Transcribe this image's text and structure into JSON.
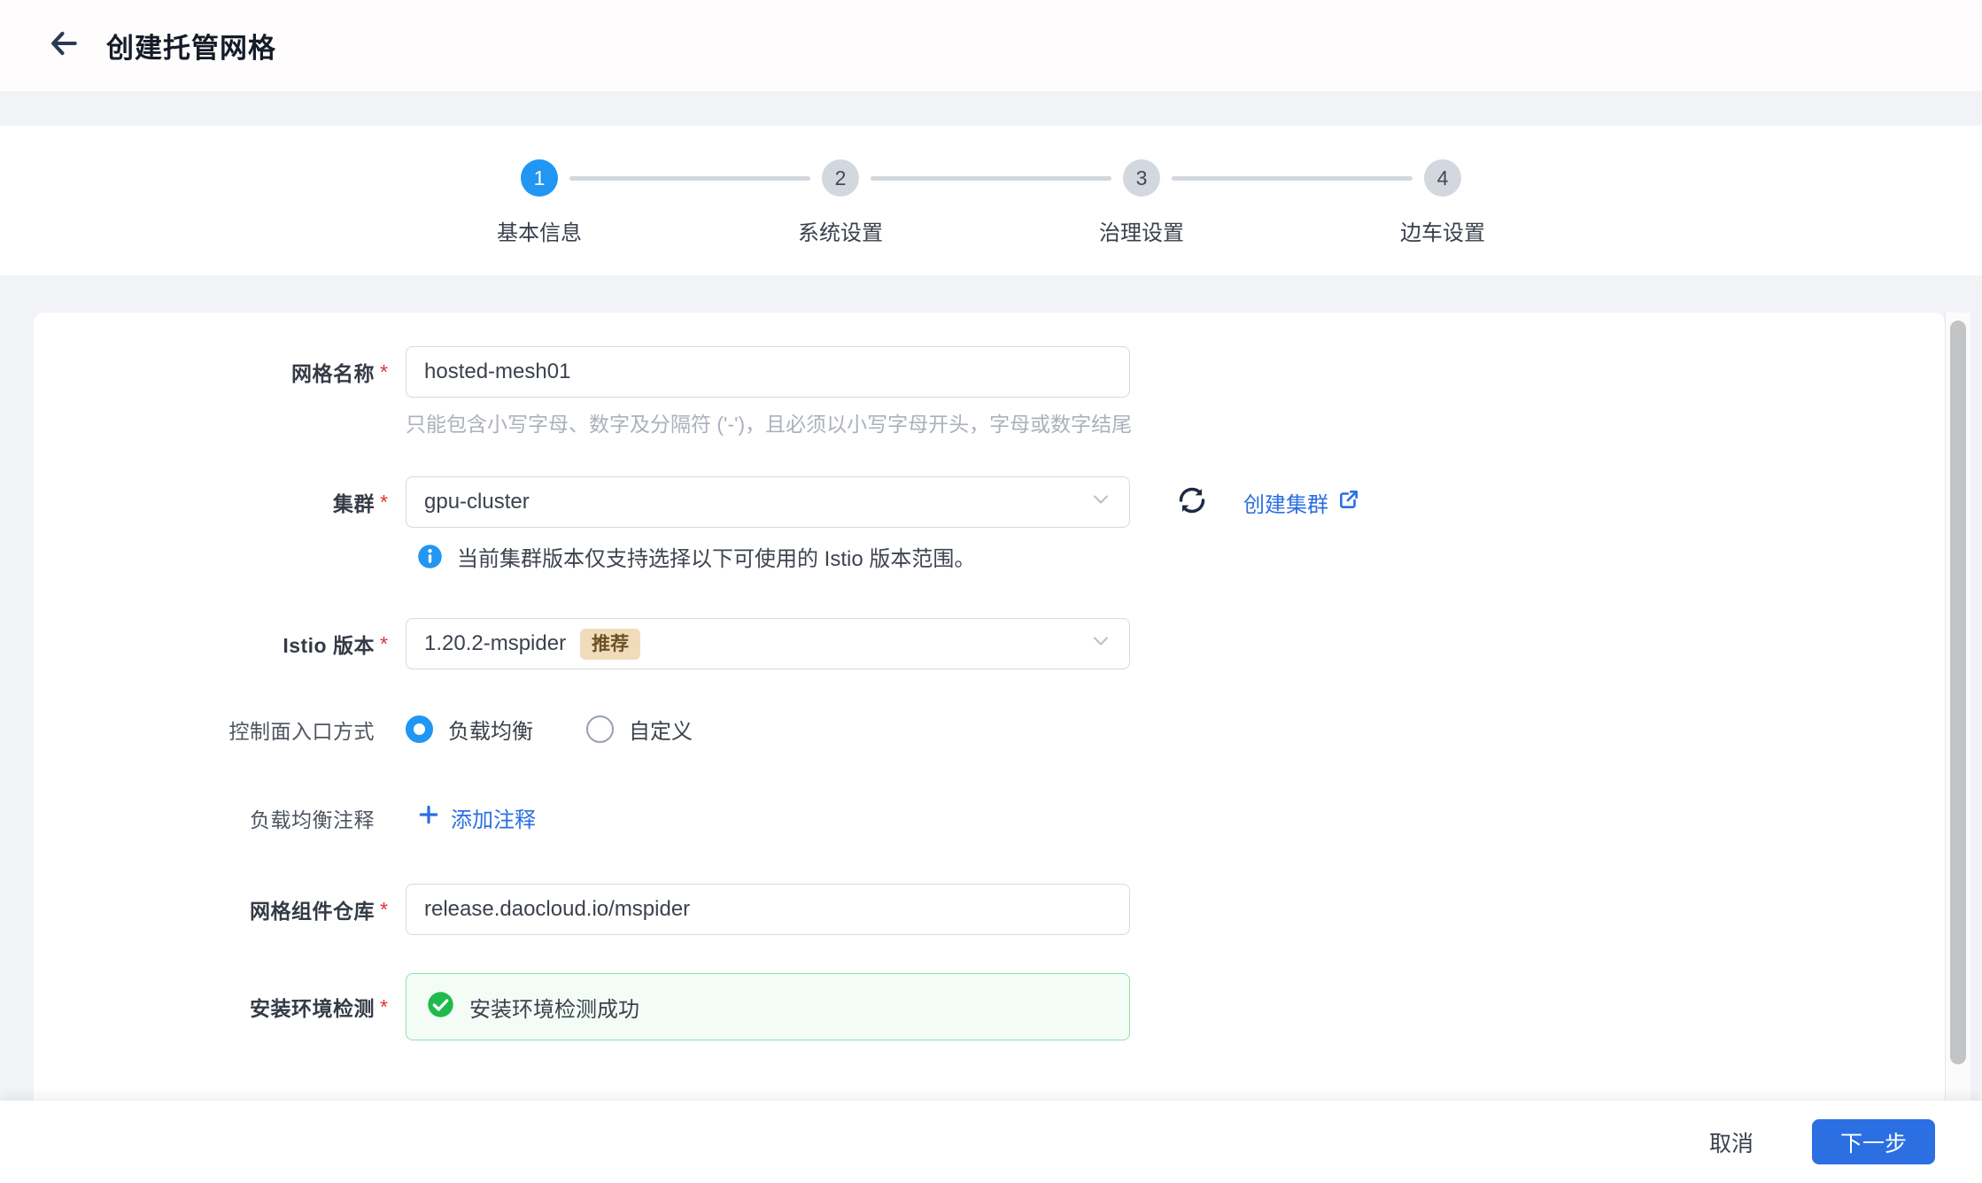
{
  "header": {
    "title": "创建托管网格"
  },
  "stepper": {
    "steps": [
      {
        "num": "1",
        "label": "基本信息",
        "active": true
      },
      {
        "num": "2",
        "label": "系统设置",
        "active": false
      },
      {
        "num": "3",
        "label": "治理设置",
        "active": false
      },
      {
        "num": "4",
        "label": "边车设置",
        "active": false
      }
    ]
  },
  "form": {
    "required_mark": "*",
    "mesh_name": {
      "label": "网格名称",
      "value": "hosted-mesh01",
      "hint": "只能包含小写字母、数字及分隔符 ('-')，且必须以小写字母开头，字母或数字结尾"
    },
    "cluster": {
      "label": "集群",
      "value": "gpu-cluster",
      "create_link": "创建集群",
      "info": "当前集群版本仅支持选择以下可使用的 Istio 版本范围。"
    },
    "istio_version": {
      "label": "Istio 版本",
      "value": "1.20.2-mspider",
      "badge": "推荐"
    },
    "entry_mode": {
      "label": "控制面入口方式",
      "options": [
        {
          "label": "负载均衡",
          "selected": true
        },
        {
          "label": "自定义",
          "selected": false
        }
      ]
    },
    "lb_annotations": {
      "label": "负载均衡注释",
      "add_link": "添加注释"
    },
    "component_repo": {
      "label": "网格组件仓库",
      "value": "release.daocloud.io/mspider"
    },
    "env_check": {
      "label": "安装环境检测",
      "success_text": "安装环境检测成功"
    }
  },
  "footer": {
    "cancel": "取消",
    "next": "下一步"
  },
  "colors": {
    "primary_blue": "#2b6fe2",
    "step_blue": "#2196f3",
    "page_bg": "#f1f3f6",
    "badge_bg": "#f0dcba",
    "badge_text": "#6d5126",
    "success_green": "#1fba4e",
    "success_bg": "#f3fdf5",
    "success_border": "#8fe0a8",
    "required_red": "#e03131"
  }
}
